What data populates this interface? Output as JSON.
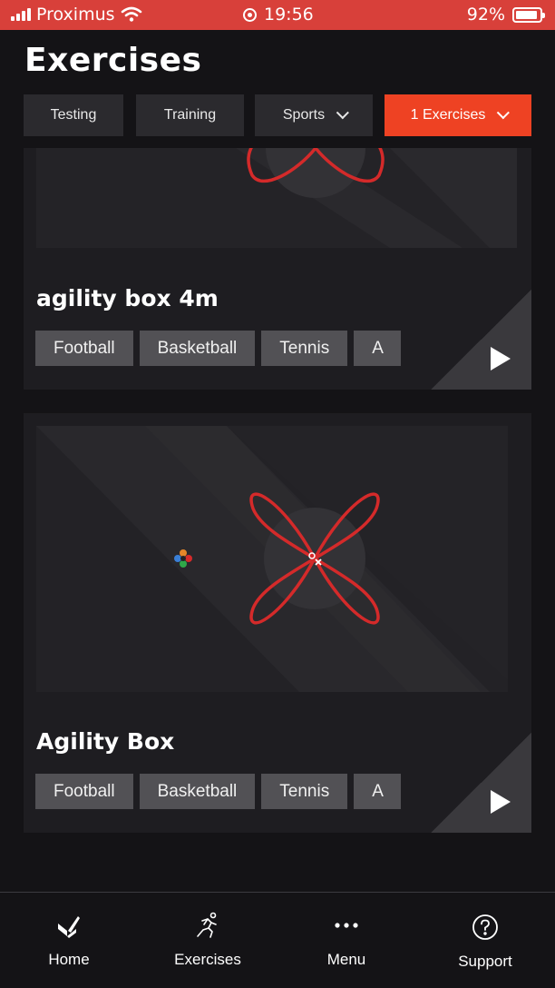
{
  "status_bar": {
    "carrier": "Proximus",
    "time": "19:56",
    "battery": "92%",
    "battery_level": 0.92
  },
  "header": {
    "title": "Exercises"
  },
  "filters": [
    {
      "label": "Testing",
      "dropdown": false,
      "active": false
    },
    {
      "label": "Training",
      "dropdown": false,
      "active": false
    },
    {
      "label": "Sports",
      "dropdown": true,
      "active": false
    },
    {
      "label": "1 Exercises",
      "dropdown": true,
      "active": true
    }
  ],
  "cards": [
    {
      "title": "agility box 4m",
      "tags": [
        "Football",
        "Basketball",
        "Tennis",
        "A"
      ]
    },
    {
      "title": "Agility Box",
      "tags": [
        "Football",
        "Basketball",
        "Tennis",
        "A"
      ]
    }
  ],
  "bottom_nav": [
    {
      "label": "Home",
      "icon": "home-logo-icon"
    },
    {
      "label": "Exercises",
      "icon": "runner-icon"
    },
    {
      "label": "Menu",
      "icon": "more-dots-icon"
    },
    {
      "label": "Support",
      "icon": "help-circle-icon"
    }
  ],
  "colors": {
    "accent": "#ee4223",
    "status_bar": "#d8403a",
    "background": "#141316",
    "card": "#1e1d21",
    "path": "#d42a2a"
  }
}
